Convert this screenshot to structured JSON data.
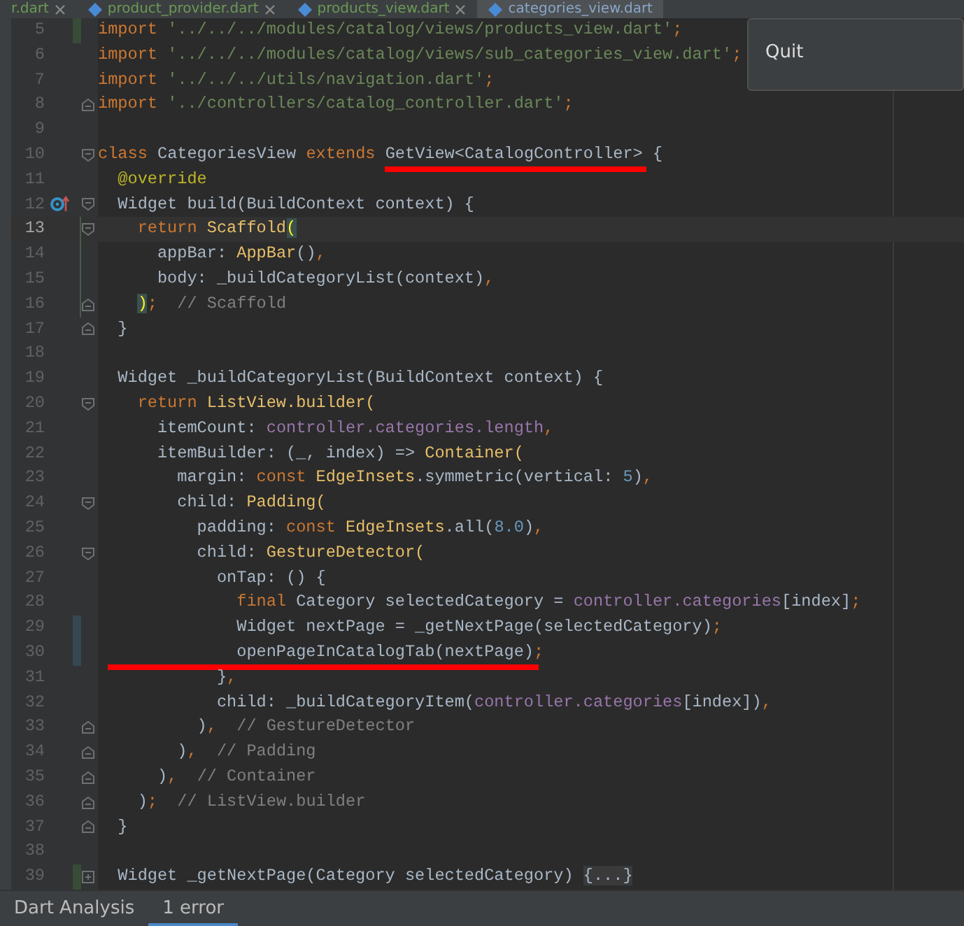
{
  "editor_tabs": [
    {
      "label": "r.dart",
      "selected": false
    },
    {
      "label": "product_provider.dart",
      "selected": false
    },
    {
      "label": "products_view.dart",
      "selected": false
    },
    {
      "label": "categories_view.dart",
      "selected": true
    }
  ],
  "popup_menu": {
    "items": [
      "Quit"
    ]
  },
  "code_lines": [
    {
      "number": "5",
      "change_marker": {
        "kind": "added"
      },
      "segments": [
        {
          "kind": "keyword",
          "text": "import"
        },
        {
          "kind": "string",
          "text": " '../../../modules/catalog/views/products_view.dart'"
        },
        {
          "kind": "punct",
          "text": ";"
        }
      ]
    },
    {
      "number": "6",
      "segments": [
        {
          "kind": "keyword",
          "text": "import"
        },
        {
          "kind": "string",
          "text": " '../../../modules/catalog/views/sub_categories_view.dart'"
        },
        {
          "kind": "punct",
          "text": ";"
        }
      ]
    },
    {
      "number": "7",
      "segments": [
        {
          "kind": "keyword",
          "text": "import"
        },
        {
          "kind": "string",
          "text": " '../../../utils/navigation.dart'"
        },
        {
          "kind": "punct",
          "text": ";"
        }
      ]
    },
    {
      "number": "8",
      "fold_marker": {
        "kind": "end"
      },
      "segments": [
        {
          "kind": "keyword",
          "text": "import"
        },
        {
          "kind": "string",
          "text": " '../controllers/catalog_controller.dart'"
        },
        {
          "kind": "punct",
          "text": ";"
        }
      ]
    },
    {
      "number": "9"
    },
    {
      "number": "10",
      "fold_marker": {
        "kind": "start"
      },
      "segments": [
        {
          "kind": "keyword",
          "text": "class"
        },
        {
          "kind": "plain",
          "text": " CategoriesView "
        },
        {
          "kind": "keyword",
          "text": "extends"
        },
        {
          "kind": "plain",
          "text": " GetView<CatalogController>",
          "underlined": true
        },
        {
          "kind": "plain",
          "text": " {"
        }
      ]
    },
    {
      "number": "11",
      "segments": [
        {
          "kind": "annotation",
          "text": "  @override"
        }
      ]
    },
    {
      "number": "12",
      "override_marker": true,
      "fold_marker": {
        "kind": "start"
      },
      "segments": [
        {
          "kind": "plain",
          "text": "  Widget build(BuildContext context) {"
        }
      ]
    },
    {
      "number": "13",
      "current": true,
      "change_marker": {
        "kind": "whitespace"
      },
      "fold_marker": {
        "kind": "start"
      },
      "segments": [
        {
          "kind": "keyword",
          "text": "    return"
        },
        {
          "kind": "type",
          "text": " Scaffold"
        },
        {
          "kind": "brace",
          "text": "("
        }
      ]
    },
    {
      "number": "14",
      "change_marker": {
        "kind": "whitespace"
      },
      "segments": [
        {
          "kind": "plain",
          "text": "      appBar: "
        },
        {
          "kind": "type",
          "text": "AppBar"
        },
        {
          "kind": "plain",
          "text": "()"
        },
        {
          "kind": "punct",
          "text": ","
        }
      ]
    },
    {
      "number": "15",
      "change_marker": {
        "kind": "whitespace"
      },
      "segments": [
        {
          "kind": "plain",
          "text": "      body: _buildCategoryList(context)"
        },
        {
          "kind": "punct",
          "text": ","
        }
      ]
    },
    {
      "number": "16",
      "change_marker": {
        "kind": "whitespace"
      },
      "fold_marker": {
        "kind": "end"
      },
      "segments": [
        {
          "kind": "brace",
          "text": "    )"
        },
        {
          "kind": "punct",
          "text": ";"
        },
        {
          "kind": "comment",
          "text": "  // Scaffold"
        }
      ]
    },
    {
      "number": "17",
      "fold_marker": {
        "kind": "end"
      },
      "segments": [
        {
          "kind": "plain",
          "text": "  }"
        }
      ]
    },
    {
      "number": "18"
    },
    {
      "number": "19",
      "segments": [
        {
          "kind": "plain",
          "text": "  Widget _buildCategoryList(BuildContext context) {"
        }
      ]
    },
    {
      "number": "20",
      "fold_marker": {
        "kind": "start"
      },
      "segments": [
        {
          "kind": "keyword",
          "text": "    return"
        },
        {
          "kind": "type",
          "text": " ListView.builder("
        }
      ]
    },
    {
      "number": "21",
      "segments": [
        {
          "kind": "plain",
          "text": "      itemCount: "
        },
        {
          "kind": "field",
          "text": "controller.categories.length"
        },
        {
          "kind": "punct",
          "text": ","
        }
      ]
    },
    {
      "number": "22",
      "segments": [
        {
          "kind": "plain",
          "text": "      itemBuilder: (_, index) => "
        },
        {
          "kind": "type",
          "text": "Container("
        }
      ]
    },
    {
      "number": "23",
      "segments": [
        {
          "kind": "plain",
          "text": "        margin: "
        },
        {
          "kind": "keyword",
          "text": "const"
        },
        {
          "kind": "type",
          "text": " EdgeInsets"
        },
        {
          "kind": "plain",
          "text": ".symmetric(vertical: "
        },
        {
          "kind": "number",
          "text": "5"
        },
        {
          "kind": "plain",
          "text": ")"
        },
        {
          "kind": "punct",
          "text": ","
        }
      ]
    },
    {
      "number": "24",
      "fold_marker": {
        "kind": "start"
      },
      "segments": [
        {
          "kind": "plain",
          "text": "        child: "
        },
        {
          "kind": "type",
          "text": "Padding("
        }
      ]
    },
    {
      "number": "25",
      "segments": [
        {
          "kind": "plain",
          "text": "          padding: "
        },
        {
          "kind": "keyword",
          "text": "const"
        },
        {
          "kind": "type",
          "text": " EdgeInsets"
        },
        {
          "kind": "plain",
          "text": ".all("
        },
        {
          "kind": "number",
          "text": "8.0"
        },
        {
          "kind": "plain",
          "text": ")"
        },
        {
          "kind": "punct",
          "text": ","
        }
      ]
    },
    {
      "number": "26",
      "fold_marker": {
        "kind": "start"
      },
      "segments": [
        {
          "kind": "plain",
          "text": "          child: "
        },
        {
          "kind": "type",
          "text": "GestureDetector("
        }
      ]
    },
    {
      "number": "27",
      "segments": [
        {
          "kind": "plain",
          "text": "            onTap: () {"
        }
      ]
    },
    {
      "number": "28",
      "segments": [
        {
          "kind": "keyword",
          "text": "              final"
        },
        {
          "kind": "plain",
          "text": " Category selectedCategory = "
        },
        {
          "kind": "field",
          "text": "controller.categories"
        },
        {
          "kind": "plain",
          "text": "[index]"
        },
        {
          "kind": "punct",
          "text": ";"
        }
      ]
    },
    {
      "number": "29",
      "change_marker": {
        "kind": "modified"
      },
      "segments": [
        {
          "kind": "plain",
          "text": "              Widget nextPage = _getNextPage(selectedCategory)"
        },
        {
          "kind": "punct",
          "text": ";"
        }
      ]
    },
    {
      "number": "30",
      "change_marker": {
        "kind": "modified"
      },
      "segments": [
        {
          "kind": "plain",
          "text": "              openPageInCatalogTab(nextPage)",
          "underlined": true
        },
        {
          "kind": "punct",
          "text": ";"
        }
      ]
    },
    {
      "number": "31",
      "segments": [
        {
          "kind": "plain",
          "text": "            }"
        },
        {
          "kind": "punct",
          "text": ","
        }
      ]
    },
    {
      "number": "32",
      "segments": [
        {
          "kind": "plain",
          "text": "            child: _buildCategoryItem("
        },
        {
          "kind": "field",
          "text": "controller.categories"
        },
        {
          "kind": "plain",
          "text": "[index])"
        },
        {
          "kind": "punct",
          "text": ","
        }
      ]
    },
    {
      "number": "33",
      "fold_marker": {
        "kind": "end"
      },
      "segments": [
        {
          "kind": "plain",
          "text": "          )"
        },
        {
          "kind": "punct",
          "text": ","
        },
        {
          "kind": "comment",
          "text": "  // GestureDetector"
        }
      ]
    },
    {
      "number": "34",
      "fold_marker": {
        "kind": "end"
      },
      "segments": [
        {
          "kind": "plain",
          "text": "        )"
        },
        {
          "kind": "punct",
          "text": ","
        },
        {
          "kind": "comment",
          "text": "  // Padding"
        }
      ]
    },
    {
      "number": "35",
      "fold_marker": {
        "kind": "end"
      },
      "segments": [
        {
          "kind": "plain",
          "text": "      )"
        },
        {
          "kind": "punct",
          "text": ","
        },
        {
          "kind": "comment",
          "text": "  // Container"
        }
      ]
    },
    {
      "number": "36",
      "fold_marker": {
        "kind": "end"
      },
      "segments": [
        {
          "kind": "plain",
          "text": "    )"
        },
        {
          "kind": "punct",
          "text": ";"
        },
        {
          "kind": "comment",
          "text": "  // ListView.builder"
        }
      ]
    },
    {
      "number": "37",
      "fold_marker": {
        "kind": "end"
      },
      "segments": [
        {
          "kind": "plain",
          "text": "  }"
        }
      ]
    },
    {
      "number": "38"
    },
    {
      "number": "39",
      "change_marker": {
        "kind": "added"
      },
      "fold_marker": {
        "kind": "collapsed"
      },
      "segments": [
        {
          "kind": "plain",
          "text": "  Widget _getNextPage(Category selectedCategory) "
        },
        {
          "kind": "folded",
          "text": "{...}"
        }
      ]
    }
  ],
  "bottom_bar": {
    "tabs": [
      {
        "label": "Dart Analysis",
        "selected": false
      },
      {
        "label": "1 error",
        "selected": true
      }
    ]
  }
}
